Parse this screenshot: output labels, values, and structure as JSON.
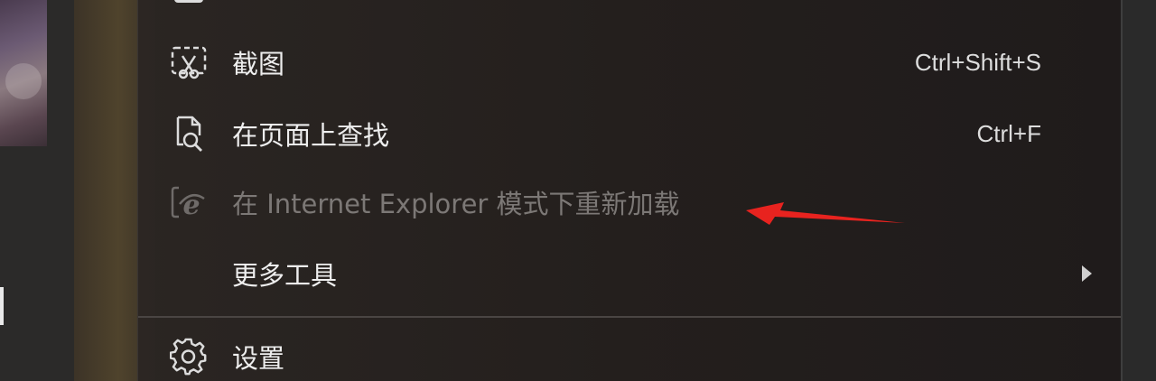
{
  "menu": {
    "items": [
      {
        "label": "截图",
        "shortcut": "Ctrl+Shift+S",
        "icon": "screenshot-icon",
        "enabled": true
      },
      {
        "label": "在页面上查找",
        "shortcut": "Ctrl+F",
        "icon": "find-in-page-icon",
        "enabled": true
      },
      {
        "label": "在 Internet Explorer 模式下重新加载",
        "shortcut": "",
        "icon": "ie-mode-icon",
        "enabled": false
      },
      {
        "label": "更多工具",
        "shortcut": "",
        "icon": "",
        "enabled": true,
        "submenu": true
      },
      {
        "label": "设置",
        "shortcut": "",
        "icon": "gear-icon",
        "enabled": true
      }
    ]
  },
  "colors": {
    "menu_bg": "#26211f",
    "text": "#eeeeee",
    "disabled_text": "#7c7876",
    "annotation": "#e8231f"
  }
}
